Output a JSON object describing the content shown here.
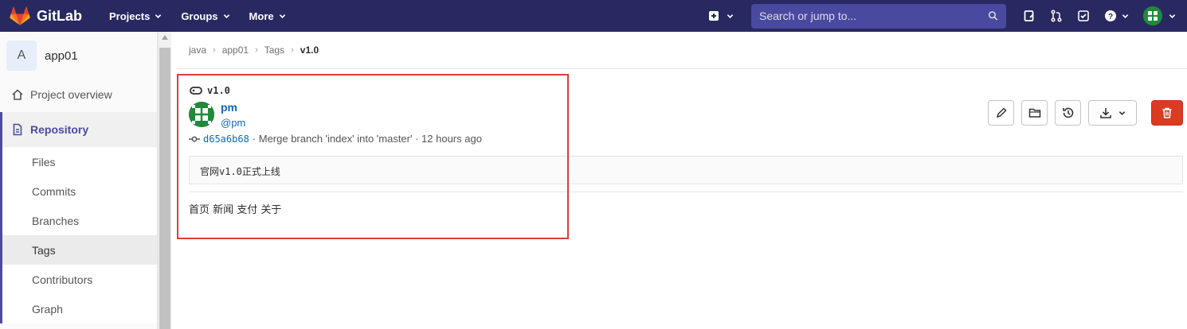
{
  "navbar": {
    "brand": "GitLab",
    "menus": [
      {
        "label": "Projects"
      },
      {
        "label": "Groups"
      },
      {
        "label": "More"
      }
    ],
    "search_placeholder": "Search or jump to...",
    "icons": [
      "plus-square-icon",
      "search-icon",
      "issues-icon",
      "merge-requests-icon",
      "todo-icon",
      "help-icon",
      "user-avatar"
    ]
  },
  "sidebar": {
    "project_initial": "A",
    "project_name": "app01",
    "overview": "Project overview",
    "section": "Repository",
    "items": [
      {
        "label": "Files"
      },
      {
        "label": "Commits"
      },
      {
        "label": "Branches"
      },
      {
        "label": "Tags"
      },
      {
        "label": "Contributors"
      },
      {
        "label": "Graph"
      }
    ],
    "active_item": "Tags"
  },
  "breadcrumb": [
    "java",
    "app01",
    "Tags",
    "v1.0"
  ],
  "tag": {
    "name": "v1.0",
    "author_name": "pm",
    "author_handle": "@pm",
    "commit_sha": "d65a6b68",
    "commit_message": "· Merge branch 'index' into 'master' · 12 hours ago",
    "message": "官网v1.0正式上线",
    "release_notes": "首页 新闻 支付 关于"
  },
  "colors": {
    "navbar_bg": "#292961",
    "accent": "#4b4ba3",
    "link": "#1068bf",
    "delete_button": "#db3b21",
    "highlight_border": "#e03b3b"
  }
}
